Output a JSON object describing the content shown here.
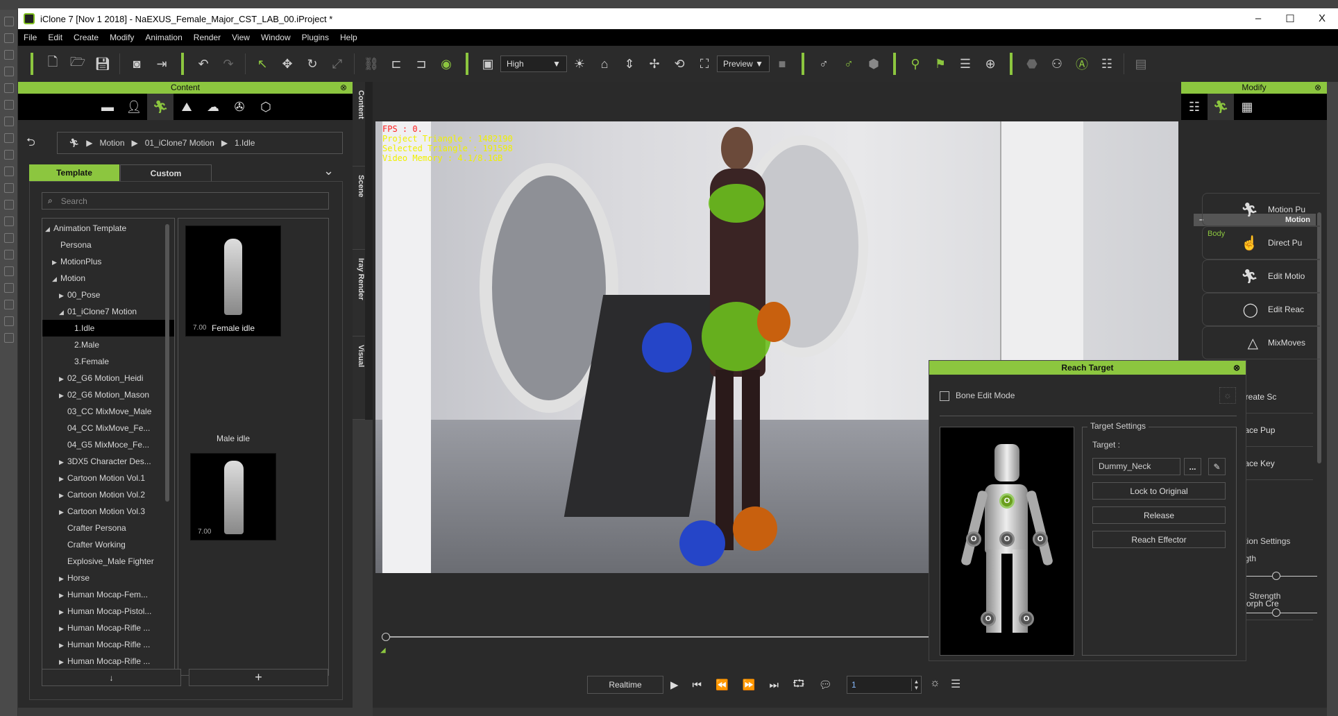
{
  "window": {
    "title": "iClone 7 [Nov  1 2018] - NaEXUS_Female_Major_CST_LAB_00.iProject *",
    "minimize": "–",
    "maximize": "☐",
    "close": "X"
  },
  "menu": [
    "File",
    "Edit",
    "Create",
    "Modify",
    "Animation",
    "Render",
    "View",
    "Window",
    "Plugins",
    "Help"
  ],
  "toolbar": {
    "quality": "High",
    "render_mode": "Preview"
  },
  "colors": {
    "accent": "#8cc63f",
    "panel": "#2a2a2a",
    "menubar": "#000000"
  },
  "content": {
    "title": "Content",
    "breadcrumb": [
      "Motion",
      "01_iClone7 Motion",
      "1.Idle"
    ],
    "tabs": [
      {
        "label": "Template",
        "active": true
      },
      {
        "label": "Custom",
        "active": false
      }
    ],
    "search_placeholder": "Search",
    "tree": [
      {
        "label": "Animation Template",
        "expander": "open",
        "level": 0
      },
      {
        "label": "Persona",
        "expander": "none",
        "level": 1
      },
      {
        "label": "MotionPlus",
        "expander": "closed",
        "level": 1
      },
      {
        "label": "Motion",
        "expander": "open",
        "level": 1
      },
      {
        "label": "00_Pose",
        "expander": "closed",
        "level": 2
      },
      {
        "label": "01_iClone7 Motion",
        "expander": "open",
        "level": 2
      },
      {
        "label": "1.Idle",
        "expander": "none",
        "level": 3,
        "selected": true
      },
      {
        "label": "2.Male",
        "expander": "none",
        "level": 3
      },
      {
        "label": "3.Female",
        "expander": "none",
        "level": 3
      },
      {
        "label": "02_G6 Motion_Heidi",
        "expander": "closed",
        "level": 2
      },
      {
        "label": "02_G6 Motion_Mason",
        "expander": "closed",
        "level": 2
      },
      {
        "label": "03_CC MixMove_Male",
        "expander": "none",
        "level": 2
      },
      {
        "label": "04_CC MixMove_Fe...",
        "expander": "none",
        "level": 2
      },
      {
        "label": "04_G5 MixMoce_Fe...",
        "expander": "none",
        "level": 2
      },
      {
        "label": "3DX5 Character Des...",
        "expander": "closed",
        "level": 2
      },
      {
        "label": "Cartoon Motion Vol.1",
        "expander": "closed",
        "level": 2
      },
      {
        "label": "Cartoon Motion Vol.2",
        "expander": "closed",
        "level": 2
      },
      {
        "label": "Cartoon Motion Vol.3",
        "expander": "closed",
        "level": 2
      },
      {
        "label": "Crafter Persona",
        "expander": "none",
        "level": 2
      },
      {
        "label": "Crafter Working",
        "expander": "none",
        "level": 2
      },
      {
        "label": "Explosive_Male Fighter",
        "expander": "none",
        "level": 2
      },
      {
        "label": "Horse",
        "expander": "closed",
        "level": 2
      },
      {
        "label": "Human Mocap-Fem...",
        "expander": "closed",
        "level": 2
      },
      {
        "label": "Human Mocap-Pistol...",
        "expander": "closed",
        "level": 2
      },
      {
        "label": "Human Mocap-Rifle ...",
        "expander": "closed",
        "level": 2
      },
      {
        "label": "Human Mocap-Rifle ...",
        "expander": "closed",
        "level": 2
      },
      {
        "label": "Human Mocap-Rifle ...",
        "expander": "closed",
        "level": 2
      }
    ],
    "thumbnails": [
      {
        "label": "Female idle",
        "version": "7.00"
      },
      {
        "label": "Male idle",
        "version": "7.00"
      }
    ],
    "bottom_buttons": [
      "↓",
      "+"
    ]
  },
  "side_tabs": [
    "Content",
    "Scene",
    "Iray Render",
    "Visual"
  ],
  "viewport": {
    "fps": "FPS : 0.",
    "project_triangle": "Project Triangle : 1482190",
    "selected_triangle": "Selected Triangle : 191598",
    "video_memory": "Video Memory : 4.1/8.1GB"
  },
  "playback": {
    "realtime": "Realtime",
    "frame": "1"
  },
  "modify": {
    "title": "Modify",
    "section": "Motion",
    "group": "Body",
    "buttons": [
      "Motion Pu",
      "Direct Pu",
      "Edit Motio",
      "Edit Reac",
      "MixMoves",
      "Create Sc",
      "Face Pup",
      "Face Key",
      "Morph Cre"
    ],
    "settings_title": "nation Settings",
    "slider1_label": "ength",
    "slider2_label": "Strength",
    "slider1_value": 0.5,
    "slider2_value": 0.5
  },
  "reach_target": {
    "title": "Reach Target",
    "bone_edit_mode": "Bone Edit Mode",
    "bone_edit_checked": false,
    "target_settings": "Target Settings",
    "target_label": "Target :",
    "target_value": "Dummy_Neck",
    "browse": "...",
    "lock": "Lock to Original",
    "release": "Release",
    "reach_effector": "Reach Effector",
    "marker_glyph": "O"
  }
}
